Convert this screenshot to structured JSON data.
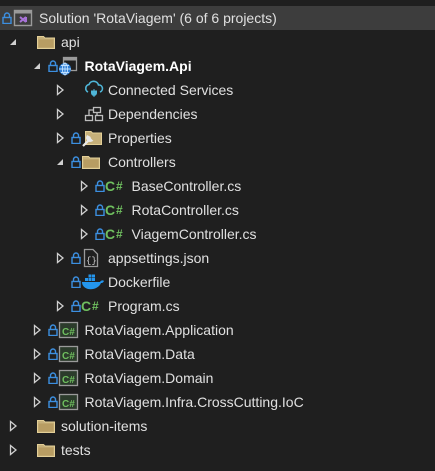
{
  "solution_explorer": {
    "colors": {
      "background": "#1f1f1f",
      "selected_row": "#3d3d3d",
      "lock": "#3c8fe0",
      "csharp": "#6fbf5f",
      "folder": "#d8c08a"
    },
    "rows": [
      {
        "level": 0,
        "expander": "none",
        "lock": true,
        "icon": "solution-icon",
        "label": "Solution 'RotaViagem' (6 of 6 projects)",
        "selected": true
      },
      {
        "level": 1,
        "expander": "expanded",
        "lock": false,
        "icon": "folder-icon",
        "label": "api"
      },
      {
        "level": 2,
        "expander": "expanded",
        "lock": true,
        "icon": "web-project-icon",
        "label": "RotaViagem.Api",
        "bold": true
      },
      {
        "level": 3,
        "expander": "collapsed",
        "lock": false,
        "icon": "connected-services-icon",
        "label": "Connected Services"
      },
      {
        "level": 3,
        "expander": "collapsed",
        "lock": false,
        "icon": "dependencies-icon",
        "label": "Dependencies"
      },
      {
        "level": 3,
        "expander": "collapsed",
        "lock": true,
        "icon": "properties-folder-icon",
        "label": "Properties"
      },
      {
        "level": 3,
        "expander": "expanded",
        "lock": true,
        "icon": "folder-icon",
        "label": "Controllers"
      },
      {
        "level": 4,
        "expander": "collapsed",
        "lock": true,
        "icon": "csharp-file-icon",
        "label": "BaseController.cs"
      },
      {
        "level": 4,
        "expander": "collapsed",
        "lock": true,
        "icon": "csharp-file-icon",
        "label": "RotaController.cs"
      },
      {
        "level": 4,
        "expander": "collapsed",
        "lock": true,
        "icon": "csharp-file-icon",
        "label": "ViagemController.cs"
      },
      {
        "level": 3,
        "expander": "collapsed",
        "lock": true,
        "icon": "json-file-icon",
        "label": "appsettings.json"
      },
      {
        "level": 3,
        "expander": "none",
        "lock": true,
        "icon": "docker-icon",
        "label": "Dockerfile"
      },
      {
        "level": 3,
        "expander": "collapsed",
        "lock": true,
        "icon": "csharp-file-icon",
        "label": "Program.cs"
      },
      {
        "level": 2,
        "expander": "collapsed",
        "lock": true,
        "icon": "csharp-project-icon",
        "label": "RotaViagem.Application"
      },
      {
        "level": 2,
        "expander": "collapsed",
        "lock": true,
        "icon": "csharp-project-icon",
        "label": "RotaViagem.Data"
      },
      {
        "level": 2,
        "expander": "collapsed",
        "lock": true,
        "icon": "csharp-project-icon",
        "label": "RotaViagem.Domain"
      },
      {
        "level": 2,
        "expander": "collapsed",
        "lock": true,
        "icon": "csharp-project-icon",
        "label": "RotaViagem.Infra.CrossCutting.IoC"
      },
      {
        "level": 1,
        "expander": "collapsed",
        "lock": false,
        "icon": "folder-icon",
        "label": "solution-items"
      },
      {
        "level": 1,
        "expander": "collapsed",
        "lock": false,
        "icon": "folder-icon",
        "label": "tests"
      }
    ]
  }
}
